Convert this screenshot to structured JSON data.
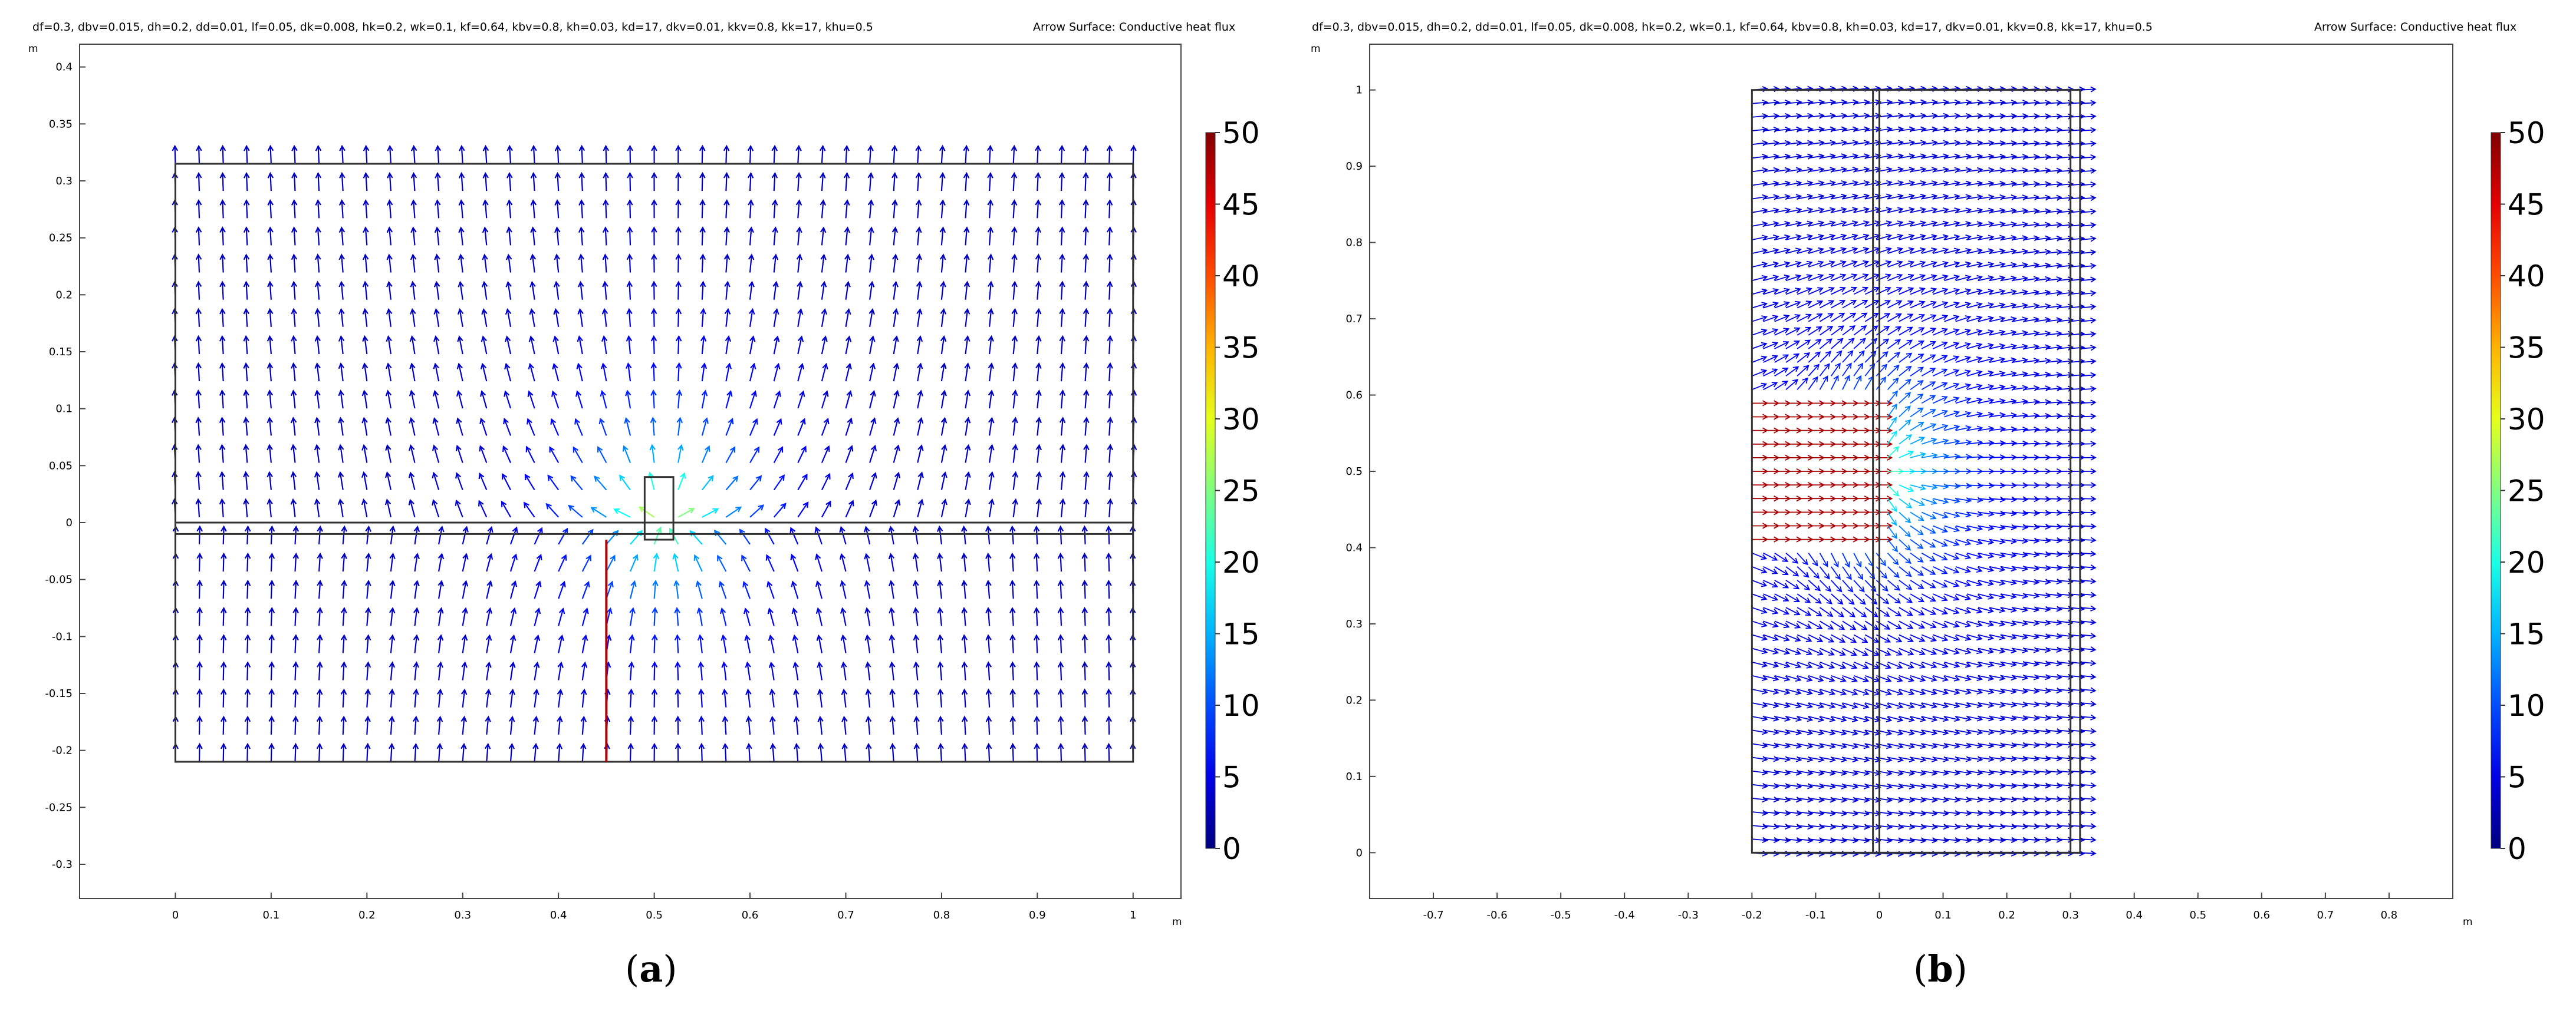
{
  "panel_labels": {
    "a_open": "(",
    "a_letter": "a",
    "a_close": ")",
    "b_open": "(",
    "b_letter": "b",
    "b_close": ")"
  },
  "chart_data": [
    {
      "type": "heatmap",
      "subtype": "arrow-surface",
      "params_text": "df=0.3, dbv=0.015, dh=0.2, dd=0.01, lf=0.05, dk=0.008, hk=0.2, wk=0.1, kf=0.64, kbv=0.8, kh=0.03, kd=17, dkv=0.01, kkv=0.8, kk=17, khu=0.5",
      "title": "Arrow Surface: Conductive heat flux",
      "xunit": "m",
      "yunit": "m",
      "xlim": [
        -0.1,
        1.05
      ],
      "ylim": [
        -0.33,
        0.42
      ],
      "xticks": [
        "0",
        "0.1",
        "0.2",
        "0.3",
        "0.4",
        "0.5",
        "0.6",
        "0.7",
        "0.8",
        "0.9",
        "1"
      ],
      "yticks": [
        "0.4",
        "0.35",
        "0.3",
        "0.25",
        "0.2",
        "0.15",
        "0.1",
        "0.05",
        "0",
        "-0.05",
        "-0.1",
        "-0.15",
        "-0.2",
        "-0.25",
        "-0.3"
      ],
      "colorbar": {
        "min": 0,
        "max": 50,
        "ticks": [
          "50",
          "45",
          "40",
          "35",
          "30",
          "25",
          "20",
          "15",
          "10",
          "5",
          "0"
        ]
      },
      "domain": {
        "x": [
          0,
          1
        ],
        "y": [
          -0.21,
          0.315
        ]
      },
      "interface_y": [
        0.0,
        -0.01
      ],
      "source": {
        "x": 0.51,
        "y": 0.0
      }
    },
    {
      "type": "heatmap",
      "subtype": "arrow-surface",
      "params_text": "df=0.3, dbv=0.015, dh=0.2, dd=0.01, lf=0.05, dk=0.008, hk=0.2, wk=0.1, kf=0.64, kbv=0.8, kh=0.03, kd=17, dkv=0.01, kkv=0.8, kk=17, khu=0.5",
      "title": "Arrow Surface: Conductive heat flux",
      "xunit": "m",
      "yunit": "m",
      "xlim": [
        -0.8,
        0.9
      ],
      "ylim": [
        -0.06,
        1.06
      ],
      "xticks": [
        "-0.7",
        "-0.6",
        "-0.5",
        "-0.4",
        "-0.3",
        "-0.2",
        "-0.1",
        "0",
        "0.1",
        "0.2",
        "0.3",
        "0.4",
        "0.5",
        "0.6",
        "0.7",
        "0.8"
      ],
      "yticks": [
        "1",
        "0.9",
        "0.8",
        "0.7",
        "0.6",
        "0.5",
        "0.4",
        "0.3",
        "0.2",
        "0.1",
        "0"
      ],
      "colorbar": {
        "min": 0,
        "max": 50,
        "ticks": [
          "50",
          "45",
          "40",
          "35",
          "30",
          "25",
          "20",
          "15",
          "10",
          "5",
          "0"
        ]
      },
      "domain": {
        "x": [
          -0.2,
          0.315
        ],
        "y": [
          0,
          1
        ]
      },
      "hot_region": {
        "x": [
          -0.2,
          0.0
        ],
        "y": [
          0.4,
          0.6
        ]
      },
      "source": {
        "x": 0.0,
        "y": 0.5
      }
    }
  ]
}
